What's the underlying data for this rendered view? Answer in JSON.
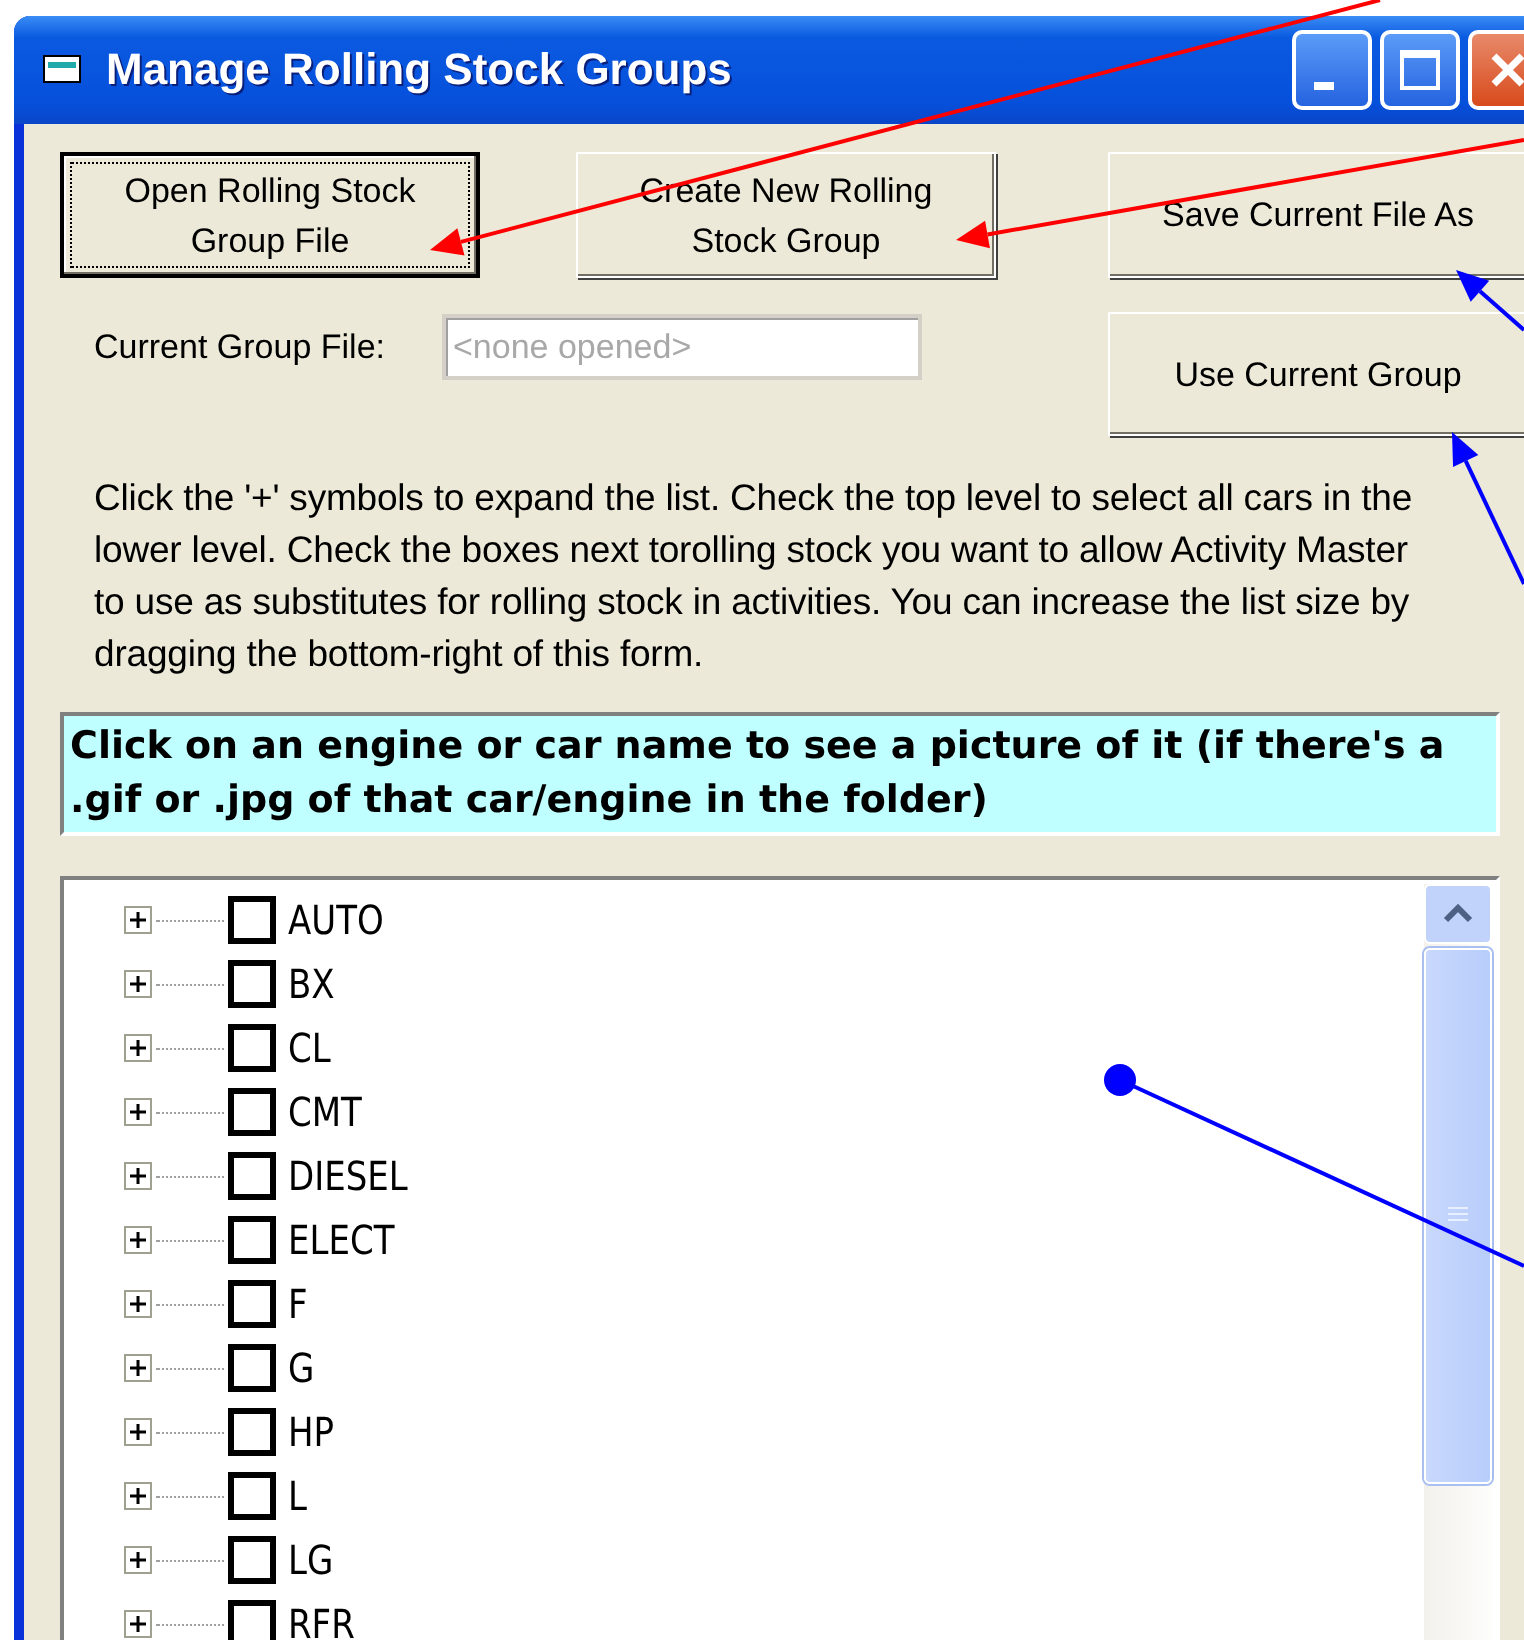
{
  "window": {
    "title": "Manage Rolling Stock Groups"
  },
  "buttons": [
    {
      "label": "Open Rolling Stock Group File",
      "focused": true
    },
    {
      "label": "Create New Rolling Stock Group",
      "focused": false
    },
    {
      "label": "Save Current File As",
      "focused": false
    },
    {
      "label": "Use Current Group",
      "focused": false
    }
  ],
  "current_group_file": {
    "label": "Current Group File:",
    "placeholder": "<none opened>",
    "disabled": true
  },
  "instructions": "Click the '+' symbols to expand the list.  Check the top level to select all cars in the lower level.  Check the boxes next torolling stock you want to allow Activity Master to use as substitutes for rolling stock in activities.  You can increase the list size by dragging the bottom-right of this form.",
  "hint": "Click on an engine or car name to see a picture of it (if there's a .gif or .jpg of that car/engine in the folder)",
  "tree": [
    {
      "label": "AUTO",
      "checked": false,
      "expanded": false
    },
    {
      "label": "BX",
      "checked": false,
      "expanded": false
    },
    {
      "label": "CL",
      "checked": false,
      "expanded": false
    },
    {
      "label": "CMT",
      "checked": false,
      "expanded": false
    },
    {
      "label": "DIESEL",
      "checked": false,
      "expanded": false
    },
    {
      "label": "ELECT",
      "checked": false,
      "expanded": false
    },
    {
      "label": "F",
      "checked": false,
      "expanded": false
    },
    {
      "label": "G",
      "checked": false,
      "expanded": false
    },
    {
      "label": "HP",
      "checked": false,
      "expanded": false
    },
    {
      "label": "L",
      "checked": false,
      "expanded": false
    },
    {
      "label": "LG",
      "checked": false,
      "expanded": false
    },
    {
      "label": "RFR",
      "checked": false,
      "expanded": false
    }
  ]
}
